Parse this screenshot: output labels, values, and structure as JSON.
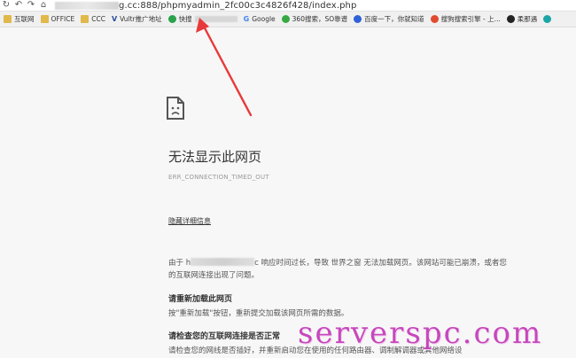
{
  "address_bar": {
    "url": "g.cc:888/phpmyadmin_2fc00c3c4826f428/index.php",
    "icons": [
      "refresh-icon",
      "back-icon",
      "forward-icon",
      "home-icon"
    ]
  },
  "bookmarks": [
    {
      "label": "互联网",
      "icon": "folder-icon"
    },
    {
      "label": "OFFICE",
      "icon": "folder-icon"
    },
    {
      "label": "CCC",
      "icon": "folder-icon"
    },
    {
      "label": "Vultr推广地址",
      "icon": "vultr-icon"
    },
    {
      "label": "快搜",
      "icon": "kuaisou-icon"
    },
    {
      "label": "Google",
      "icon": "google-icon"
    },
    {
      "label": "360搜索，SO靠谱",
      "icon": "360-icon"
    },
    {
      "label": "百度一下，你就知道",
      "icon": "baidu-icon"
    },
    {
      "label": "搜狗搜索引擎 - 上...",
      "icon": "sogou-icon"
    },
    {
      "label": "柔那遇",
      "icon": "site-icon"
    }
  ],
  "error_page": {
    "title": "无法显示此网页",
    "error_code": "ERR_CONNECTION_TIMED_OUT",
    "details_link": "隐藏详细信息",
    "description_prefix": "由于 h",
    "description_suffix": "c 响应时间过长，导致 世界之窗 无法加载网页。该网站可能已崩溃，或者您的互联网连接出现了问题。",
    "section1_title": "请重新加载此网页",
    "section1_text": "按\"重新加载\"按钮，重新提交加载该网页所需的数据。",
    "section2_title": "请检查您的互联网连接是否正常",
    "section2_text": "请检查您的网线是否插好，并重新启动您在使用的任何路由器、调制解调器或其他网络设"
  },
  "watermark": "serverspc.com",
  "colors": {
    "arrow": "#e8393a",
    "watermark": "#c23ab8",
    "page_bg": "#f7f7f7"
  }
}
